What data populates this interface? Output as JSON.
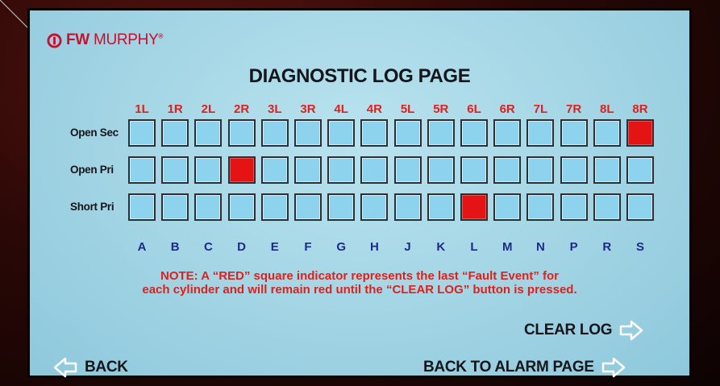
{
  "logo": {
    "bold": "FW",
    "light": "MURPHY",
    "mark": "®"
  },
  "title": "DIAGNOSTIC LOG PAGE",
  "columns": [
    "1L",
    "1R",
    "2L",
    "2R",
    "3L",
    "3R",
    "4L",
    "4R",
    "5L",
    "5R",
    "6L",
    "6R",
    "7L",
    "7R",
    "8L",
    "8R"
  ],
  "cylinders": [
    "A",
    "B",
    "C",
    "D",
    "E",
    "F",
    "G",
    "H",
    "J",
    "K",
    "L",
    "M",
    "N",
    "P",
    "R",
    "S"
  ],
  "rows": [
    {
      "label": "Open Sec",
      "red_index": 15
    },
    {
      "label": "Open Pri",
      "red_index": 3
    },
    {
      "label": "Short Pri",
      "red_index": 10
    }
  ],
  "note": {
    "line1": "NOTE: A “RED” square indicator represents the last “Fault Event”  for",
    "line2": "each cylinder and will remain red until the “CLEAR LOG” button is pressed."
  },
  "actions": {
    "clear_log": "CLEAR LOG",
    "back": "BACK",
    "back_to_alarm": "BACK TO ALARM PAGE"
  },
  "icons": {
    "back": "arrow-left-outline-icon",
    "forward": "arrow-right-outline-icon",
    "logo": "murphy-logo-icon"
  },
  "colors": {
    "fault": "#e41414",
    "normal": "#8ed3ee",
    "column_label": "#e0201c",
    "cylinder_label": "#1d2a8a"
  }
}
